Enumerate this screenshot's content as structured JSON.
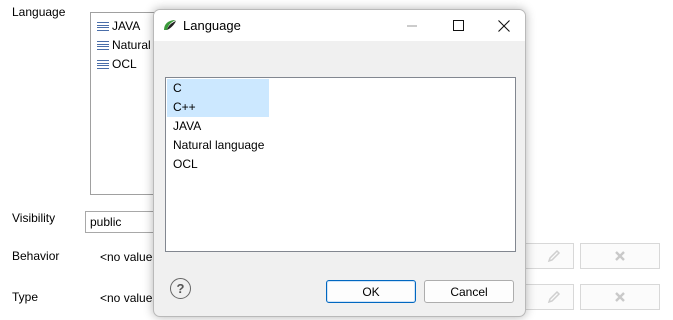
{
  "background": {
    "language_label": "Language",
    "language_items": [
      "JAVA",
      "Natural",
      "OCL"
    ],
    "visibility_label": "Visibility",
    "visibility_value": "public",
    "behavior_label": "Behavior",
    "behavior_value": "<no value",
    "type_label": "Type",
    "type_value": "<no value",
    "edit_icon": "pencil-icon",
    "delete_icon": "close-x-icon"
  },
  "dialog": {
    "title": "Language",
    "app_icon": "swirl-logo-icon",
    "title_buttons": [
      "minimize",
      "maximize",
      "close"
    ],
    "items": [
      {
        "label": "C",
        "selected": true
      },
      {
        "label": "C++",
        "selected": true
      },
      {
        "label": "JAVA",
        "selected": false
      },
      {
        "label": "Natural language",
        "selected": false
      },
      {
        "label": "OCL",
        "selected": false
      }
    ],
    "help_icon": "question-circle-icon",
    "ok_label": "OK",
    "cancel_label": "Cancel"
  }
}
